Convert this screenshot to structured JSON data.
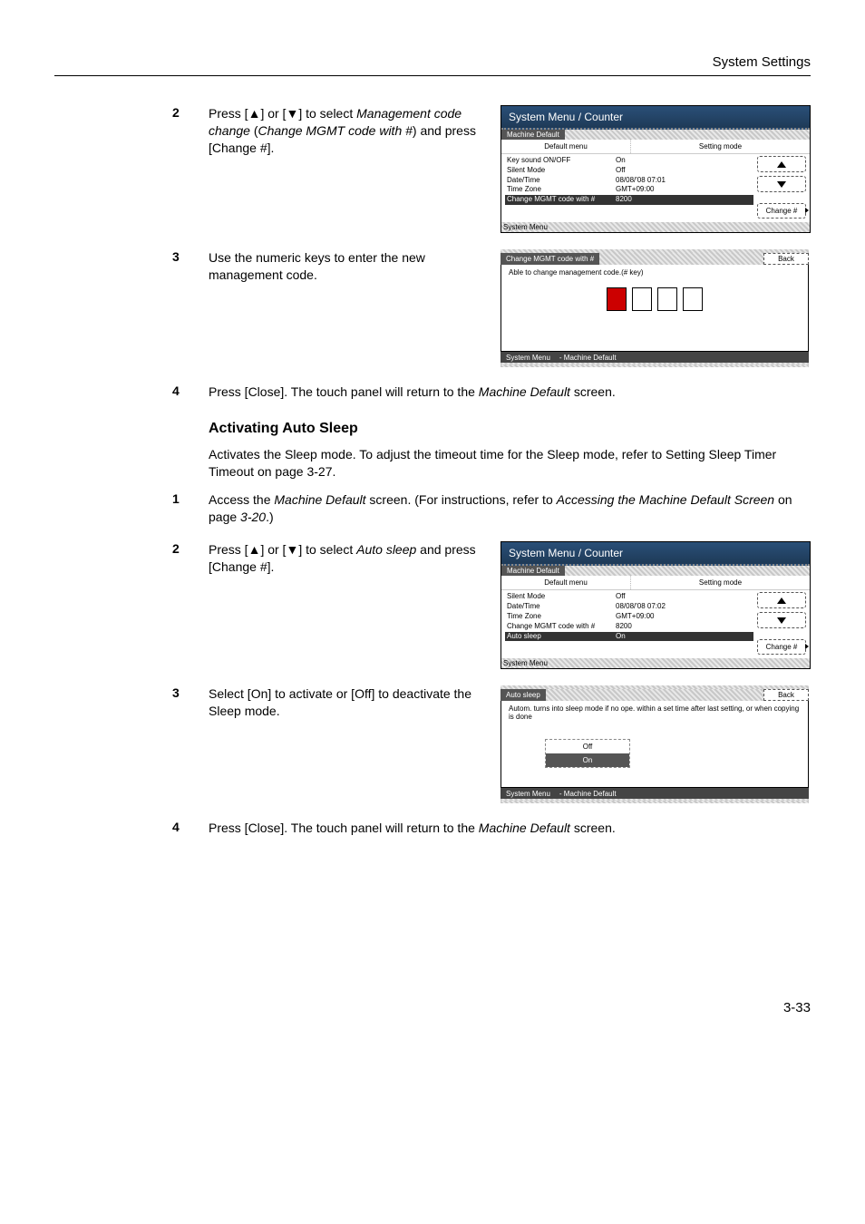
{
  "header": {
    "section": "System Settings"
  },
  "steps_a": {
    "s2": {
      "num": "2",
      "line1a": "Press [",
      "line1b": "] or [",
      "line1c": "] to select ",
      "ital1": "Management code change",
      "mid": " (",
      "ital2": "Change MGMT code with #",
      "tail": ") and press [Change #]."
    },
    "s3": {
      "num": "3",
      "text": "Use the numeric keys to enter the new management code."
    },
    "s4": {
      "num": "4",
      "pre": "Press [Close]. The touch panel will return to the ",
      "ital": "Machine Default",
      "post": " screen."
    }
  },
  "section_b": {
    "title": "Activating Auto Sleep",
    "intro_pre": "Activates the Sleep mode. To adjust the timeout time for the Sleep mode, refer to ",
    "intro_link": "Setting Sleep Timer Timeout",
    "intro_mid": " on page ",
    "intro_page": "3-27",
    "intro_post": ".",
    "s1": {
      "num": "1",
      "pre": "Access the ",
      "ital1": "Machine Default",
      "mid": " screen. (For instructions, refer to ",
      "ital2": "Accessing the Machine Default Screen",
      "mid2": " on page ",
      "page": "3-20",
      "post": ".)"
    },
    "s2": {
      "num": "2",
      "pre": "Press [",
      "mid1": "] or [",
      "mid2": "] to select ",
      "ital": "Auto sleep",
      "post": " and press [Change #]."
    },
    "s3": {
      "num": "3",
      "text": "Select [On] to activate or [Off] to deactivate the Sleep mode."
    },
    "s4": {
      "num": "4",
      "pre": "Press [Close]. The touch panel will return to the ",
      "ital": "Machine Default",
      "post": " screen."
    }
  },
  "screen1": {
    "title": "System Menu / Counter",
    "tab": "Machine Default",
    "col1": "Default menu",
    "col2": "Setting mode",
    "rows": [
      {
        "k": "Key sound ON/OFF",
        "v": "On"
      },
      {
        "k": "Silent Mode",
        "v": "Off"
      },
      {
        "k": "Date/Time",
        "v": "08/08/'08 07:01"
      },
      {
        "k": "Time Zone",
        "v": "GMT+09:00"
      },
      {
        "k": "Change MGMT code with #",
        "v": "8200",
        "sel": true
      }
    ],
    "change": "Change #",
    "footer": "System Menu"
  },
  "screen2": {
    "label": "Change MGMT code with #",
    "back": "Back",
    "msg": "Able to change management code.(# key)",
    "foot1": "System Menu",
    "foot2": "-   Machine Default"
  },
  "screen3": {
    "title": "System Menu / Counter",
    "tab": "Machine Default",
    "col1": "Default menu",
    "col2": "Setting mode",
    "rows": [
      {
        "k": "Silent Mode",
        "v": "Off"
      },
      {
        "k": "Date/Time",
        "v": "08/08/'08 07:02"
      },
      {
        "k": "Time Zone",
        "v": "GMT+09:00"
      },
      {
        "k": "Change MGMT code with #",
        "v": "8200"
      },
      {
        "k": "Auto sleep",
        "v": "On",
        "sel": true
      }
    ],
    "change": "Change #",
    "footer": "System Menu"
  },
  "screen4": {
    "label": "Auto sleep",
    "back": "Back",
    "msg": "Autom. turns into sleep mode if no ope. within a set time after last setting, or when copying is done",
    "opt_off": "Off",
    "opt_on": "On",
    "foot1": "System Menu",
    "foot2": "-   Machine Default"
  },
  "pagenum": "3-33"
}
